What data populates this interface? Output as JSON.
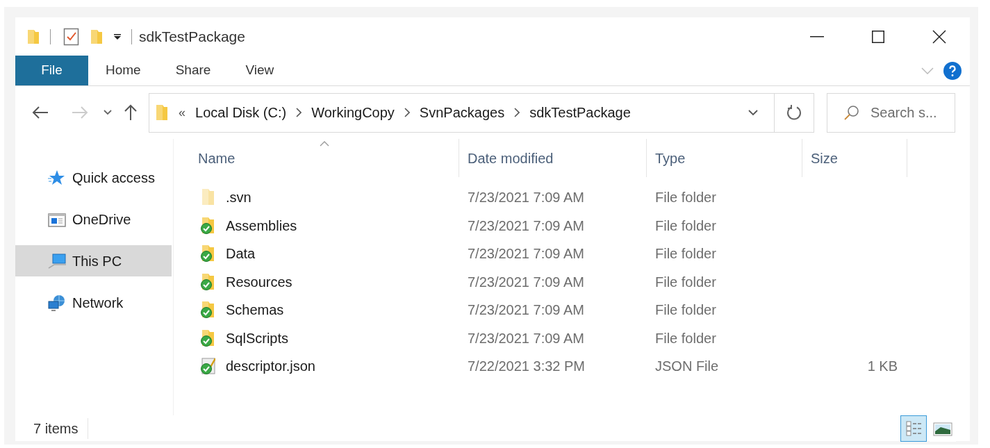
{
  "window": {
    "title": "sdkTestPackage"
  },
  "ribbon": {
    "tabs": [
      {
        "label": "File",
        "selected": true
      },
      {
        "label": "Home",
        "selected": false
      },
      {
        "label": "Share",
        "selected": false
      },
      {
        "label": "View",
        "selected": false
      }
    ]
  },
  "navigation": {
    "back_disabled": false,
    "forward_disabled": true
  },
  "address_bar": {
    "overflow": "«",
    "segments": [
      "Local Disk (C:)",
      "WorkingCopy",
      "SvnPackages",
      "sdkTestPackage"
    ]
  },
  "search": {
    "placeholder": "Search s..."
  },
  "sidebar": {
    "items": [
      {
        "label": "Quick access",
        "kind": "quick-access",
        "selected": false
      },
      {
        "label": "OneDrive",
        "kind": "onedrive",
        "selected": false
      },
      {
        "label": "This PC",
        "kind": "pc",
        "selected": true
      },
      {
        "label": "Network",
        "kind": "network",
        "selected": false
      }
    ]
  },
  "table": {
    "columns": [
      {
        "label": "Name",
        "sorted": true
      },
      {
        "label": "Date modified",
        "sorted": false
      },
      {
        "label": "Type",
        "sorted": false
      },
      {
        "label": "Size",
        "sorted": false
      }
    ],
    "rows": [
      {
        "kind": "folder",
        "name": ".svn",
        "date": "7/23/2021 7:09 AM",
        "type": "File folder"
      },
      {
        "kind": "svn-folder",
        "name": "Assemblies",
        "date": "7/23/2021 7:09 AM",
        "type": "File folder"
      },
      {
        "kind": "svn-folder",
        "name": "Data",
        "date": "7/23/2021 7:09 AM",
        "type": "File folder"
      },
      {
        "kind": "svn-folder",
        "name": "Resources",
        "date": "7/23/2021 7:09 AM",
        "type": "File folder"
      },
      {
        "kind": "svn-folder",
        "name": "Schemas",
        "date": "7/23/2021 7:09 AM",
        "type": "File folder"
      },
      {
        "kind": "svn-folder",
        "name": "SqlScripts",
        "date": "7/23/2021 7:09 AM",
        "type": "File folder"
      },
      {
        "kind": "svn-file",
        "name": "descriptor.json",
        "date": "7/22/2021 3:32 PM",
        "type": "JSON File",
        "size": "1 KB"
      }
    ]
  },
  "status_bar": {
    "item_count": "7 items",
    "views": [
      {
        "kind": "details",
        "selected": true
      },
      {
        "kind": "large-icons",
        "selected": false
      }
    ]
  }
}
